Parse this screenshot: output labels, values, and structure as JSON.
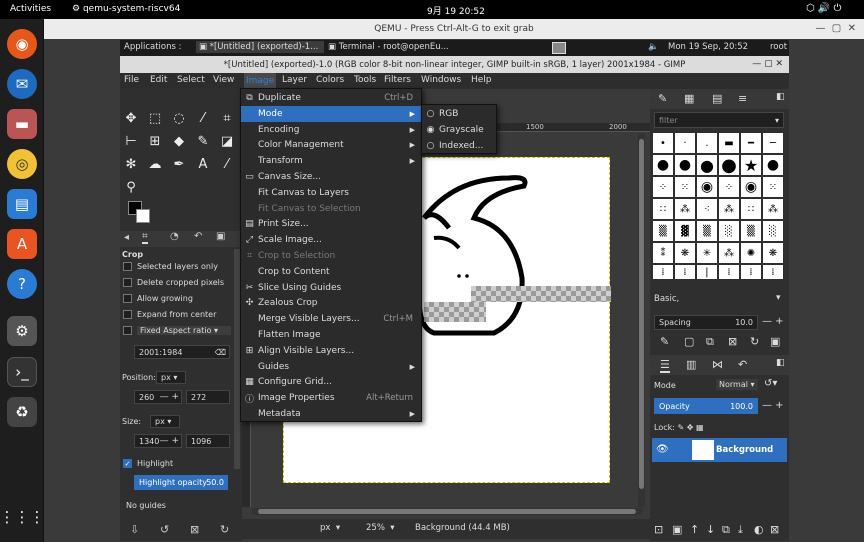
{
  "topbar": {
    "activities": "Activities",
    "app": "qemu-system-riscv64",
    "clock": "9月 19 20:52"
  },
  "qemu": {
    "title": "QEMU - Press Ctrl-Alt-G to exit grab"
  },
  "guest_panel": {
    "applications": "Applications :",
    "task1": "*[Untitled] (exported)-1...",
    "task2": "Terminal - root@openEu...",
    "datetime": "Mon 19 Sep, 20:52",
    "user": "root"
  },
  "gimp": {
    "title": "*[Untitled] (exported)-1.0 (RGB color 8-bit non-linear integer, GIMP built-in sRGB, 1 layer) 2001x1984 - GIMP",
    "menus": [
      "File",
      "Edit",
      "Select",
      "View",
      "Image",
      "Layer",
      "Colors",
      "Tools",
      "Filters",
      "Windows",
      "Help"
    ]
  },
  "image_menu": {
    "items": [
      {
        "icon": "duplicate-icon",
        "glyph": "⧉",
        "label": "Duplicate",
        "shortcut": "Ctrl+D",
        "disabled": false,
        "submenu": false
      },
      {
        "icon": "",
        "glyph": "",
        "label": "Mode",
        "shortcut": "",
        "disabled": false,
        "submenu": true,
        "selected": true
      },
      {
        "icon": "",
        "glyph": "",
        "label": "Encoding",
        "shortcut": "",
        "disabled": false,
        "submenu": true
      },
      {
        "icon": "",
        "glyph": "",
        "label": "Color Management",
        "shortcut": "",
        "disabled": false,
        "submenu": true
      },
      {
        "icon": "",
        "glyph": "",
        "label": "Transform",
        "shortcut": "",
        "disabled": false,
        "submenu": true
      },
      {
        "icon": "canvas-size-icon",
        "glyph": "▭",
        "label": "Canvas Size...",
        "shortcut": "",
        "disabled": false,
        "submenu": false
      },
      {
        "icon": "",
        "glyph": "",
        "label": "Fit Canvas to Layers",
        "shortcut": "",
        "disabled": false,
        "submenu": false
      },
      {
        "icon": "",
        "glyph": "",
        "label": "Fit Canvas to Selection",
        "shortcut": "",
        "disabled": true,
        "submenu": false
      },
      {
        "icon": "print-size-icon",
        "glyph": "▤",
        "label": "Print Size...",
        "shortcut": "",
        "disabled": false,
        "submenu": false
      },
      {
        "icon": "scale-image-icon",
        "glyph": "⤢",
        "label": "Scale Image...",
        "shortcut": "",
        "disabled": false,
        "submenu": false
      },
      {
        "icon": "crop-icon",
        "glyph": "⌗",
        "label": "Crop to Selection",
        "shortcut": "",
        "disabled": true,
        "submenu": false
      },
      {
        "icon": "",
        "glyph": "",
        "label": "Crop to Content",
        "shortcut": "",
        "disabled": false,
        "submenu": false
      },
      {
        "icon": "slice-icon",
        "glyph": "✂",
        "label": "Slice Using Guides",
        "shortcut": "",
        "disabled": false,
        "submenu": false
      },
      {
        "icon": "zealous-crop-icon",
        "glyph": "✣",
        "label": "Zealous Crop",
        "shortcut": "",
        "disabled": false,
        "submenu": false
      },
      {
        "icon": "",
        "glyph": "",
        "label": "Merge Visible Layers...",
        "shortcut": "Ctrl+M",
        "disabled": false,
        "submenu": false
      },
      {
        "icon": "",
        "glyph": "",
        "label": "Flatten Image",
        "shortcut": "",
        "disabled": false,
        "submenu": false
      },
      {
        "icon": "align-icon",
        "glyph": "⊞",
        "label": "Align Visible Layers...",
        "shortcut": "",
        "disabled": false,
        "submenu": false
      },
      {
        "icon": "",
        "glyph": "",
        "label": "Guides",
        "shortcut": "",
        "disabled": false,
        "submenu": true
      },
      {
        "icon": "grid-icon",
        "glyph": "▦",
        "label": "Configure Grid...",
        "shortcut": "",
        "disabled": false,
        "submenu": false
      },
      {
        "icon": "info-icon",
        "glyph": "ⓘ",
        "label": "Image Properties",
        "shortcut": "Alt+Return",
        "disabled": false,
        "submenu": false
      },
      {
        "icon": "",
        "glyph": "",
        "label": "Metadata",
        "shortcut": "",
        "disabled": false,
        "submenu": true
      }
    ]
  },
  "mode_submenu": {
    "items": [
      {
        "label": "RGB",
        "checked": false
      },
      {
        "label": "Grayscale",
        "checked": true
      },
      {
        "label": "Indexed...",
        "checked": false
      }
    ]
  },
  "ruler": {
    "mark1": "1500",
    "mark2": "2000"
  },
  "tool_options": {
    "title": "Crop",
    "selected_layers_only": "Selected layers only",
    "delete_cropped_pixels": "Delete cropped pixels",
    "allow_growing": "Allow growing",
    "expand_from_center": "Expand from center",
    "fixed_aspect": "Fixed Aspect ratio",
    "aspect_value": "2001:1984",
    "position_label": "Position:",
    "position_unit": "px",
    "pos_x": "260",
    "pos_y": "272",
    "size_label": "Size:",
    "size_unit": "px",
    "size_w": "1340",
    "size_h": "1096",
    "highlight": "Highlight",
    "highlight_opacity_label": "Highlight opacity",
    "highlight_opacity": "50.0",
    "guides": "No guides"
  },
  "status": {
    "unit": "px",
    "zoom": "25%",
    "info": "Background (44.4 MB)"
  },
  "brushes": {
    "filter": "filter",
    "brush_name": "Basic,",
    "spacing_label": "Spacing",
    "spacing": "10.0"
  },
  "layers": {
    "mode_label": "Mode",
    "mode_value": "Normal",
    "opacity_label": "Opacity",
    "opacity": "100.0",
    "lock_label": "Lock:",
    "layer_name": "Background"
  }
}
